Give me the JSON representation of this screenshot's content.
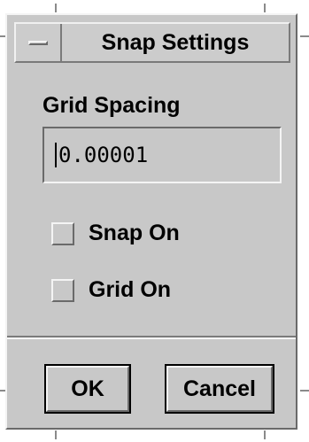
{
  "dialog": {
    "title": "Snap Settings",
    "menu_icon": "window-menu-icon"
  },
  "grid": {
    "label": "Grid Spacing",
    "value": "0.00001"
  },
  "options": {
    "snap_label": "Snap On",
    "snap_checked": false,
    "grid_label": "Grid On",
    "grid_checked": false
  },
  "buttons": {
    "ok_label": "OK",
    "cancel_label": "Cancel"
  },
  "colors": {
    "background": "#c8c8c8",
    "highlight": "#f4f4f4",
    "shadow": "#6a6a6a"
  }
}
